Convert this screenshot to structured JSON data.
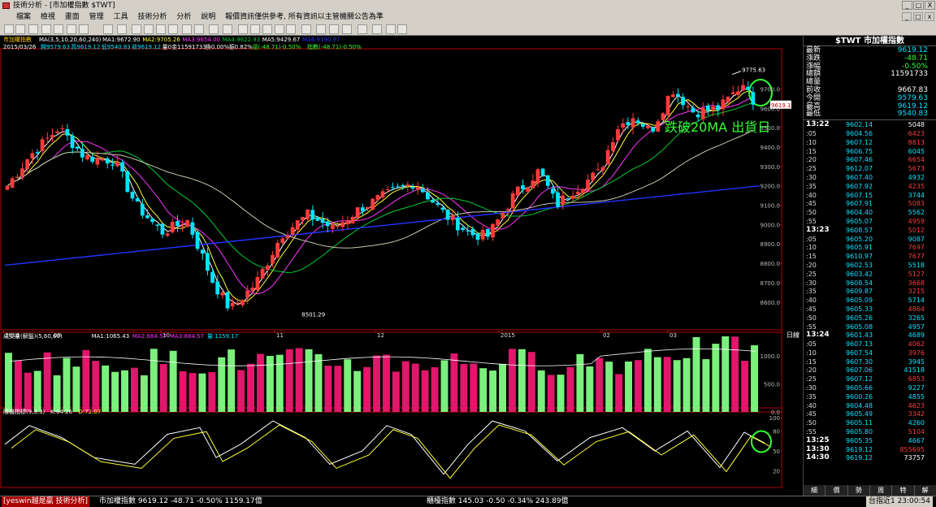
{
  "window": {
    "title": "技術分析 - [市加權指數 $TWT]",
    "min": "_",
    "max": "□",
    "close": "X"
  },
  "menu": [
    "檔案",
    "檢視",
    "畫面",
    "管理",
    "工具",
    "技術分析",
    "分析",
    "說明",
    "報價資訊僅供參考, 所有資訊以主管機關公告為準"
  ],
  "colors": {
    "up": "#ff3b3b",
    "down": "#00e5ff",
    "ma5": "#ffffff",
    "ma10": "#ffff33",
    "ma20": "#ff33ff",
    "ma60": "#00cc33",
    "ma240": "#2233ff",
    "volume_up": "#e0176b",
    "volume_down": "#7cf07c",
    "kd_k": "#ffffff",
    "kd_d": "#ffff33",
    "annotation": "#33ff33",
    "axis": "#b00000"
  },
  "price_chart": {
    "legend_name": "市加權指數",
    "legend_ma": "MA(3,5,10,20,60,240)",
    "legend_values": [
      {
        "text": "MA1:9672.90",
        "color": "#ffffff"
      },
      {
        "text": "MA2:9705.26",
        "color": "#ffff33"
      },
      {
        "text": "MA3:9654.00",
        "color": "#ff33ff"
      },
      {
        "text": "MA4:9622.93",
        "color": "#00cc33"
      },
      {
        "text": "MA5:9429.67",
        "color": "#ffffff"
      },
      {
        "text": "MA6:9190.97",
        "color": "#2233ff"
      }
    ],
    "info_line": [
      {
        "text": "2015/03/26",
        "color": "#ffffff"
      },
      {
        "text": "開9579.63",
        "color": "#00e5ff"
      },
      {
        "text": "高9619.12",
        "color": "#00e5ff"
      },
      {
        "text": "低9540.83",
        "color": "#00e5ff"
      },
      {
        "text": "收9619.12",
        "color": "#00e5ff"
      },
      {
        "text": "量0",
        "color": "#ffffff"
      },
      {
        "text": "金11591733",
        "color": "#ffffff"
      },
      {
        "text": "換0.00%",
        "color": "#ffffff"
      },
      {
        "text": "振0.82%",
        "color": "#ffffff"
      },
      {
        "text": "漲(-48.71)-0.50%",
        "color": "#33ff33"
      },
      {
        "text": "指數(-48.71)-0.50%",
        "color": "#33ff33"
      }
    ],
    "y_labels": [
      "9700.0",
      "9600.0",
      "9500.0",
      "9400.0",
      "9300.0",
      "9200.0",
      "9100.0",
      "9000.0",
      "8900.0",
      "8800.0",
      "8700.0",
      "8600.0"
    ],
    "price_tag": "9619.1",
    "high_label": "9775.63",
    "low_label": "8501.29",
    "annotation": "跌破20MA 出貨日",
    "x_labels": [
      "2014",
      "09",
      "10",
      "11",
      "12",
      "2015",
      "02",
      "03"
    ],
    "period_label": "日線"
  },
  "volume_chart": {
    "legend": [
      {
        "text": "成交量(解盤)(5,60,60)",
        "color": "#ffffff"
      },
      {
        "text": "MA1:1065.43",
        "color": "#ffffff"
      },
      {
        "text": "MA2:884.57",
        "color": "#ff33ff"
      },
      {
        "text": "MA3:884.57",
        "color": "#ff33ff"
      },
      {
        "text": "量:1159.17",
        "color": "#00e5ff"
      }
    ],
    "y_labels": [
      "1000.0",
      "500.0",
      "0.0"
    ]
  },
  "kd_chart": {
    "legend": [
      {
        "text": "隨機指標(9,3,3)",
        "color": "#ffffff"
      },
      {
        "text": "K:64.26",
        "color": "#ffffff"
      },
      {
        "text": "D:72.07",
        "color": "#ffff33"
      }
    ],
    "y_labels": [
      "100",
      "80",
      "50",
      "20"
    ]
  },
  "quote_panel": {
    "symbol": "$TWT",
    "name": "市加權指數",
    "rows": [
      {
        "label": "最新",
        "value": "9619.12",
        "color": "#00e5ff"
      },
      {
        "label": "漲跌",
        "value": "-48.71",
        "color": "#33ff33"
      },
      {
        "label": "漲幅",
        "value": "-0.50%",
        "color": "#33ff33"
      },
      {
        "label": "總額",
        "value": "11591733",
        "color": "#ffffff"
      },
      {
        "label": "總量",
        "value": "",
        "color": "#ffffff"
      },
      {
        "label": "前收",
        "value": "9667.83",
        "color": "#ffffff"
      },
      {
        "label": "今開",
        "value": "9579.63",
        "color": "#00e5ff"
      },
      {
        "label": "最高",
        "value": "9619.12",
        "color": "#00e5ff"
      },
      {
        "label": "最低",
        "value": "9540.83",
        "color": "#00e5ff"
      }
    ],
    "ticks": [
      {
        "t": "13:22",
        "p": "9602.14",
        "v": "5048",
        "vc": "#ffffff"
      },
      {
        "t": ":05",
        "p": "9604.56",
        "v": "6423",
        "vc": "#ff3b3b"
      },
      {
        "t": ":10",
        "p": "9607.12",
        "v": "8813",
        "vc": "#ff3b3b"
      },
      {
        "t": ":15",
        "p": "9606.75",
        "v": "6045",
        "vc": "#00e5ff"
      },
      {
        "t": ":20",
        "p": "9607.46",
        "v": "6654",
        "vc": "#ff3b3b"
      },
      {
        "t": ":25",
        "p": "9612.07",
        "v": "5673",
        "vc": "#ff3b3b"
      },
      {
        "t": ":30",
        "p": "9607.40",
        "v": "4932",
        "vc": "#00e5ff"
      },
      {
        "t": ":35",
        "p": "9607.92",
        "v": "4235",
        "vc": "#ff3b3b"
      },
      {
        "t": ":40",
        "p": "9607.15",
        "v": "3744",
        "vc": "#00e5ff"
      },
      {
        "t": ":45",
        "p": "9607.91",
        "v": "5083",
        "vc": "#ff3b3b"
      },
      {
        "t": ":50",
        "p": "9604.40",
        "v": "5562",
        "vc": "#00e5ff"
      },
      {
        "t": ":55",
        "p": "9605.07",
        "v": "4959",
        "vc": "#ff3b3b"
      },
      {
        "t": "13:23",
        "p": "9608.57",
        "v": "5012",
        "vc": "#ff3b3b"
      },
      {
        "t": ":05",
        "p": "9605.20",
        "v": "9087",
        "vc": "#00e5ff"
      },
      {
        "t": ":10",
        "p": "9605.91",
        "v": "7697",
        "vc": "#ff3b3b"
      },
      {
        "t": ":15",
        "p": "9610.97",
        "v": "7677",
        "vc": "#ff3b3b"
      },
      {
        "t": ":20",
        "p": "9602.53",
        "v": "5518",
        "vc": "#00e5ff"
      },
      {
        "t": ":25",
        "p": "9603.42",
        "v": "5127",
        "vc": "#ff3b3b"
      },
      {
        "t": ":30",
        "p": "9608.54",
        "v": "3668",
        "vc": "#ff3b3b"
      },
      {
        "t": ":35",
        "p": "9609.87",
        "v": "3215",
        "vc": "#ff3b3b"
      },
      {
        "t": ":40",
        "p": "9605.09",
        "v": "5714",
        "vc": "#00e5ff"
      },
      {
        "t": ":45",
        "p": "9605.33",
        "v": "4864",
        "vc": "#ff3b3b"
      },
      {
        "t": ":50",
        "p": "9605.26",
        "v": "3265",
        "vc": "#00e5ff"
      },
      {
        "t": ":55",
        "p": "9605.08",
        "v": "4957",
        "vc": "#00e5ff"
      },
      {
        "t": "13:24",
        "p": "9601.43",
        "v": "4689",
        "vc": "#00e5ff"
      },
      {
        "t": ":05",
        "p": "9607.13",
        "v": "4062",
        "vc": "#ff3b3b"
      },
      {
        "t": ":10",
        "p": "9607.54",
        "v": "3976",
        "vc": "#ff3b3b"
      },
      {
        "t": ":15",
        "p": "9607.30",
        "v": "3945",
        "vc": "#00e5ff"
      },
      {
        "t": ":20",
        "p": "9607.06",
        "v": "41518",
        "vc": "#00e5ff"
      },
      {
        "t": ":25",
        "p": "9607.12",
        "v": "6853",
        "vc": "#ff3b3b"
      },
      {
        "t": ":30",
        "p": "9605.66",
        "v": "9227",
        "vc": "#00e5ff"
      },
      {
        "t": ":35",
        "p": "9600.26",
        "v": "4855",
        "vc": "#00e5ff"
      },
      {
        "t": ":40",
        "p": "9604.48",
        "v": "4623",
        "vc": "#ff3b3b"
      },
      {
        "t": ":45",
        "p": "9605.49",
        "v": "3342",
        "vc": "#ff3b3b"
      },
      {
        "t": ":50",
        "p": "9605.11",
        "v": "4260",
        "vc": "#00e5ff"
      },
      {
        "t": ":55",
        "p": "9605.80",
        "v": "5104",
        "vc": "#ff3b3b"
      },
      {
        "t": "13:25",
        "p": "9605.35",
        "v": "4667",
        "vc": "#00e5ff"
      },
      {
        "t": "13:30",
        "p": "9619.12",
        "v": "855695",
        "vc": "#ff3b3b"
      },
      {
        "t": "14:30",
        "p": "9619.12",
        "v": "73757",
        "vc": "#ffffff"
      }
    ],
    "tabs": [
      "細",
      "價",
      "勢",
      "周",
      "特",
      "解"
    ]
  },
  "status": {
    "brand": "[yeswin越是贏 技術分析]",
    "index1": "市加權指數  9619.12  -48.71  -0.50%  1159.17億",
    "index2": "櫃檯指數  145.03  -0.50  -0.34%  243.89億",
    "clock": "台指近1  23:00:54"
  }
}
